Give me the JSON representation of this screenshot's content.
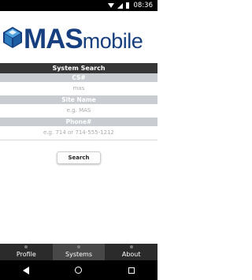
{
  "status_bar": {
    "time": "08:36"
  },
  "brand": {
    "logo_bold": "MAS",
    "logo_light": "mobile"
  },
  "search": {
    "title": "System Search",
    "fields": [
      {
        "label": "CS#",
        "value": "",
        "placeholder": "mas"
      },
      {
        "label": "Site Name",
        "value": "",
        "placeholder": "e.g. MAS"
      },
      {
        "label": "Phone#",
        "value": "",
        "placeholder": "e.g. 714 or 714-555-1212"
      }
    ],
    "button_label": "Search"
  },
  "tabs": [
    {
      "label": "Profile",
      "active": false
    },
    {
      "label": "Systems",
      "active": true
    },
    {
      "label": "About",
      "active": false
    }
  ],
  "colors": {
    "brand_blue": "#173f7f",
    "logo_cube_blue": "#2c7bbf",
    "header_dark": "#363636",
    "label_gray": "#c9ccd0",
    "tab_bar": "#2b2b2b",
    "tab_active": "#484848"
  },
  "icons": [
    "wifi-icon",
    "signal-icon",
    "battery-icon",
    "back-icon",
    "home-icon",
    "recent-apps-icon"
  ]
}
